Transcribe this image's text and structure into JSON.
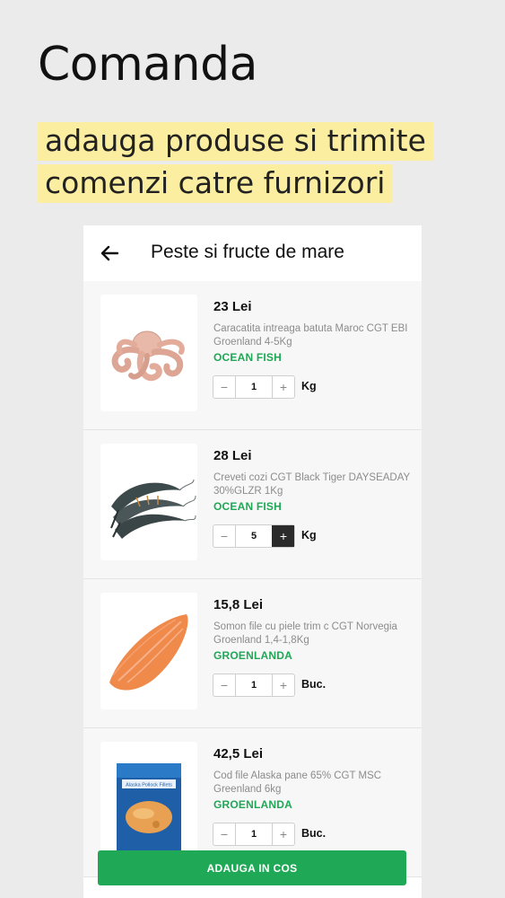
{
  "promo": {
    "title": "Comanda",
    "subtitle_line1": "adauga produse si trimite",
    "subtitle_line2": "comenzi catre furnizori",
    "highlight_color": "#fbeea0"
  },
  "header": {
    "title": "Peste si fructe de mare",
    "back_icon": "arrow-left-icon"
  },
  "products": [
    {
      "price": "23 Lei",
      "description": "Caracatita intreaga batuta Maroc  CGT EBI Groenland 4-5Kg",
      "supplier": "OCEAN FISH",
      "quantity": "1",
      "unit": "Kg",
      "image": "octopus"
    },
    {
      "price": "28 Lei",
      "description": "Creveti cozi CGT Black Tiger DAYSEADAY 30%GLZR 1Kg",
      "supplier": "OCEAN FISH",
      "quantity": "5",
      "unit": "Kg",
      "image": "shrimp"
    },
    {
      "price": "15,8 Lei",
      "description": "Somon file cu piele trim c CGT Norvegia Groenland 1,4-1,8Kg",
      "supplier": "GROENLANDA",
      "quantity": "1",
      "unit": "Buc.",
      "image": "salmon-fillet"
    },
    {
      "price": "42,5 Lei",
      "description": "Cod file Alaska pane 65% CGT MSC Greenland 6kg",
      "supplier": "GROENLANDA",
      "quantity": "1",
      "unit": "Buc.",
      "image": "fish-package",
      "package_label": "Alaska Pollock Fillets"
    }
  ],
  "stepper": {
    "minus_symbol": "−",
    "plus_symbol": "+"
  },
  "cart": {
    "button_label": "ADAUGA IN COS"
  },
  "colors": {
    "accent_green": "#1fa855",
    "background": "#ebebeb"
  }
}
